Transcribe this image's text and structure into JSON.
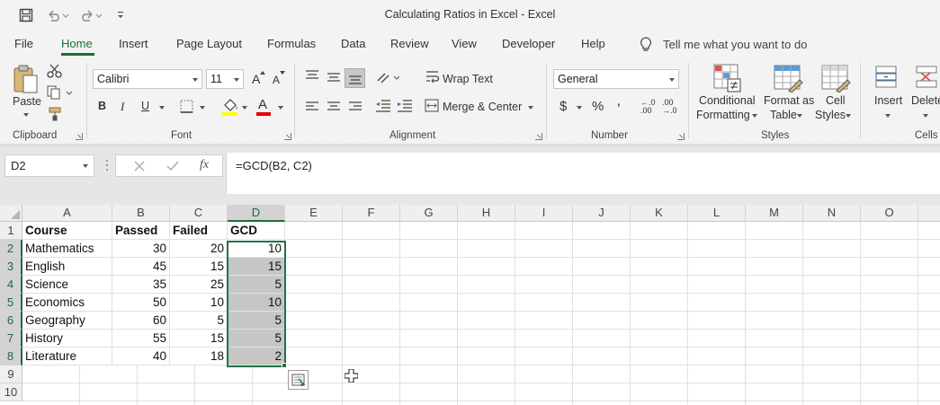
{
  "window": {
    "title": "Calculating Ratios in Excel  -  Excel"
  },
  "tabs": [
    "File",
    "Home",
    "Insert",
    "Page Layout",
    "Formulas",
    "Data",
    "Review",
    "View",
    "Developer",
    "Help"
  ],
  "active_tab": "Home",
  "tell_me": "Tell me what you want to do",
  "ribbon": {
    "clipboard": {
      "paste": "Paste",
      "label": "Clipboard"
    },
    "font": {
      "name": "Calibri",
      "size": "11",
      "bold": "B",
      "italic": "I",
      "underline": "U",
      "grow": "A",
      "shrink": "A",
      "font_color_glyph": "A",
      "label": "Font"
    },
    "alignment": {
      "wrap": "Wrap Text",
      "merge": "Merge & Center",
      "label": "Alignment"
    },
    "number": {
      "format": "General",
      "currency": "$",
      "percent": "%",
      "comma": "‚",
      "inc_decimal": "←.0\n.00",
      "dec_decimal": ".00\n→.0",
      "label": "Number"
    },
    "styles": {
      "conditional_1": "Conditional",
      "conditional_2": "Formatting",
      "format_table_1": "Format as",
      "format_table_2": "Table",
      "cell_styles_1": "Cell",
      "cell_styles_2": "Styles",
      "label": "Styles"
    },
    "cells": {
      "insert": "Insert",
      "delete": "Delete",
      "label": "Cells"
    }
  },
  "formula_bar": {
    "name_box": "D2",
    "fx": "fx",
    "formula": "=GCD(B2, C2)"
  },
  "sheet": {
    "columns": [
      "A",
      "B",
      "C",
      "D",
      "E",
      "F",
      "G",
      "H",
      "I",
      "J",
      "K",
      "L",
      "M",
      "N",
      "O"
    ],
    "selected_column": "D",
    "row_numbers": [
      "1",
      "2",
      "3",
      "4",
      "5",
      "6",
      "7",
      "8",
      "9",
      "10"
    ],
    "headers": [
      "Course",
      "Passed",
      "Failed",
      "GCD"
    ],
    "rows": [
      [
        "Mathematics",
        "30",
        "20",
        "10"
      ],
      [
        "English",
        "45",
        "15",
        "15"
      ],
      [
        "Science",
        "35",
        "25",
        "5"
      ],
      [
        "Economics",
        "50",
        "10",
        "10"
      ],
      [
        "Geography",
        "60",
        "5",
        "5"
      ],
      [
        "History",
        "55",
        "15",
        "5"
      ],
      [
        "Literature",
        "40",
        "18",
        "2"
      ]
    ]
  },
  "colors": {
    "accent": "#217346",
    "selection_fill": "#c6c6c6",
    "header_fill": "#efefef"
  }
}
